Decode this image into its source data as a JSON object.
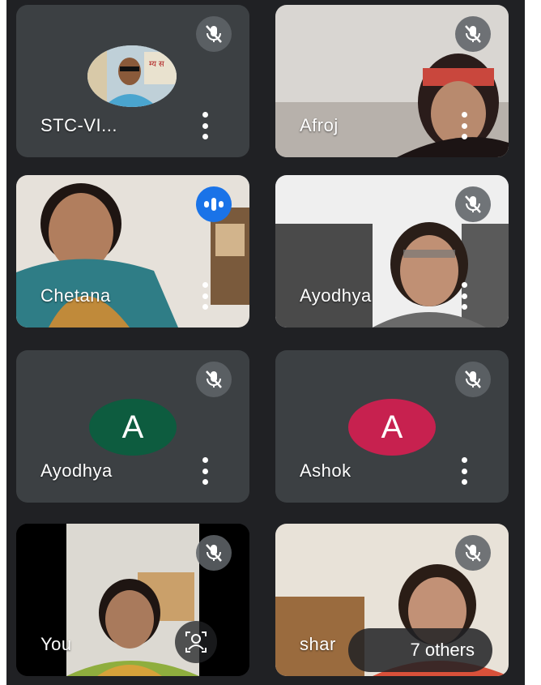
{
  "tiles": [
    {
      "name": "STC-VI...",
      "mic": "mic-off-icon"
    },
    {
      "name": "Afroj",
      "mic": "mic-off-icon"
    },
    {
      "name": "Chetana",
      "mic": "speaking-indicator-icon"
    },
    {
      "name": "Ayodhya",
      "mic": "mic-off-icon"
    },
    {
      "name": "Ayodhya",
      "initial": "A",
      "avatar_color": "#0d5c3f",
      "mic": "mic-off-icon"
    },
    {
      "name": "Ashok",
      "initial": "A",
      "avatar_color": "#c7214f",
      "mic": "mic-off-icon"
    },
    {
      "name": "You",
      "mic": "mic-off-icon",
      "control": "visual-effects-icon"
    },
    {
      "name": "shar",
      "mic": "mic-off-icon"
    }
  ],
  "overflow": {
    "label": "7 others"
  },
  "colors": {
    "background": "#202124",
    "tile": "#3c4043",
    "speaking": "#1a73e8",
    "mic_badge": "#5f6368"
  }
}
